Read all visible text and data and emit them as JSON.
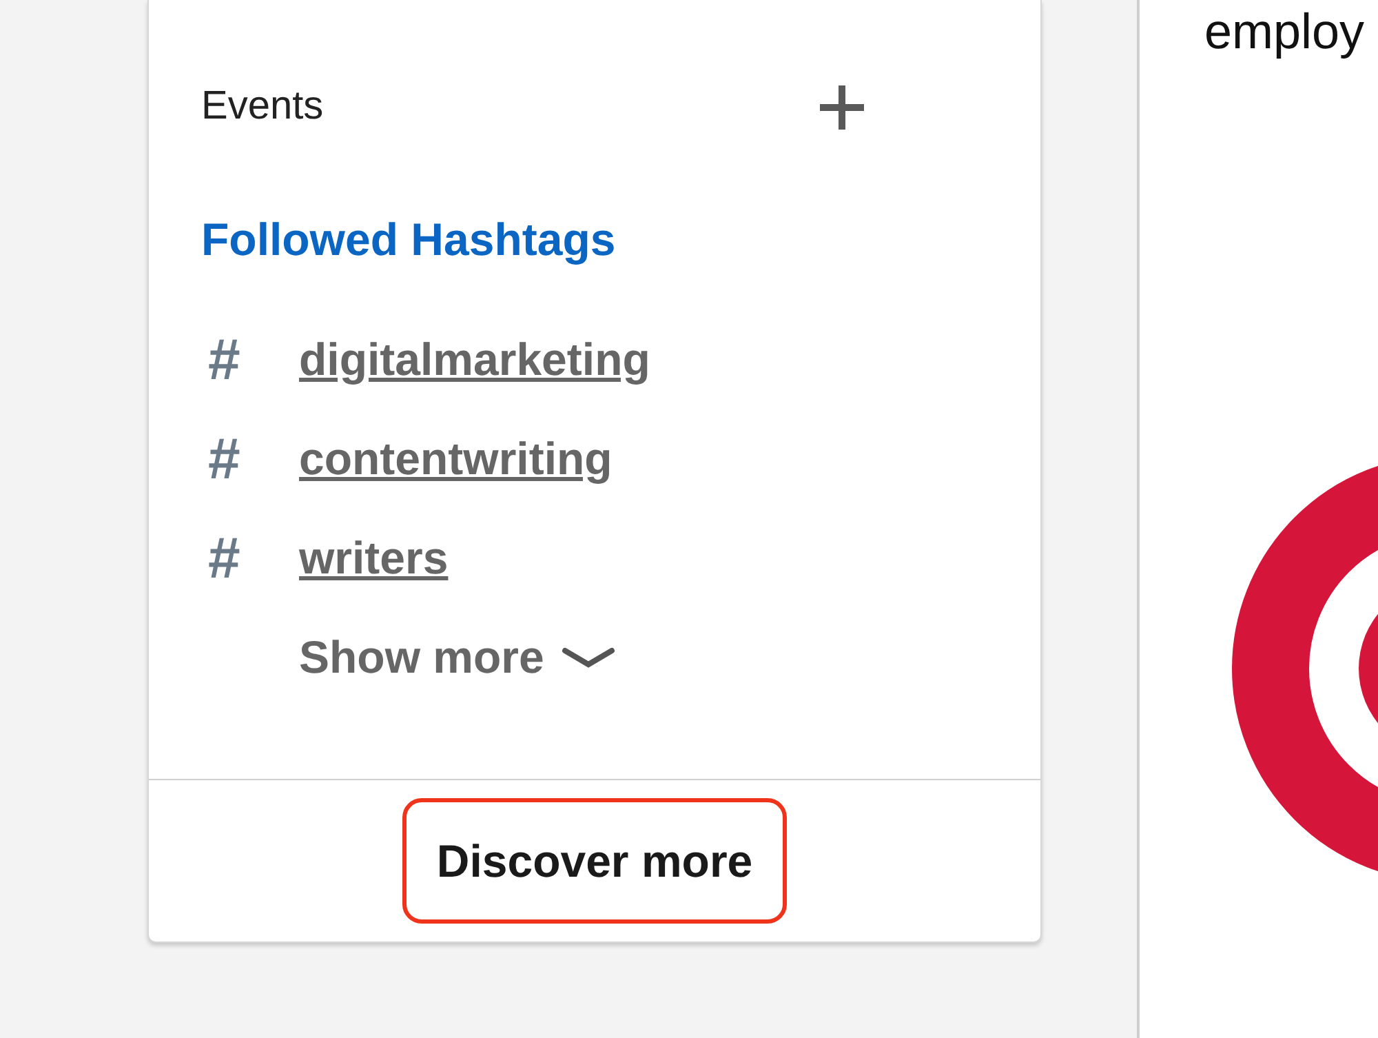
{
  "sidebar": {
    "events": {
      "label": "Events"
    },
    "hashtags_heading": "Followed Hashtags",
    "hashtags": [
      {
        "icon": "#",
        "label": "digitalmarketing"
      },
      {
        "icon": "#",
        "label": "contentwriting"
      },
      {
        "icon": "#",
        "label": "writers"
      }
    ],
    "show_more": "Show more",
    "discover": {
      "label": "Discover more",
      "highlighted": true
    }
  },
  "main": {
    "text": "employ"
  }
}
